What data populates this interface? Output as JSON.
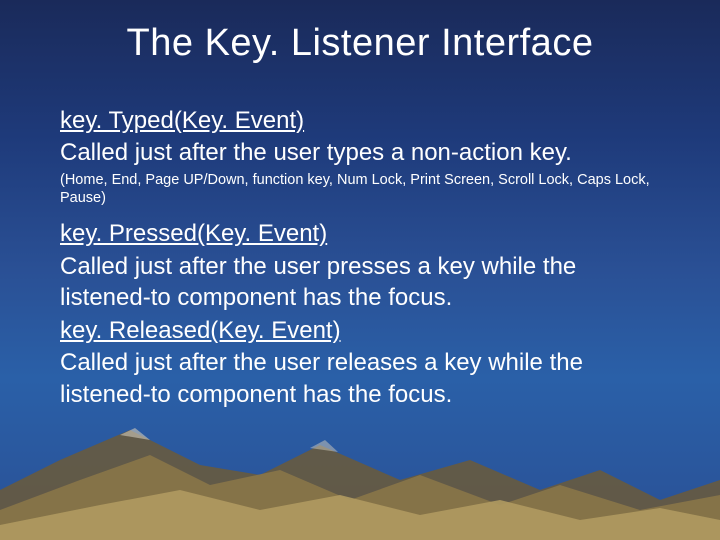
{
  "title": "The Key. Listener Interface",
  "sections": [
    {
      "method": "key. Typed(Key. Event)",
      "desc": "Called just after the user types a non-action key.",
      "note": "(Home, End, Page UP/Down, function key, Num Lock, Print Screen, Scroll Lock, Caps Lock, Pause)"
    },
    {
      "method": "key. Pressed(Key. Event)",
      "desc": "Called just after the user presses a key while the listened-to component has the focus."
    },
    {
      "method": "key. Released(Key. Event)",
      "desc": "Called just after the user releases a key while the listened-to component has the focus."
    }
  ]
}
